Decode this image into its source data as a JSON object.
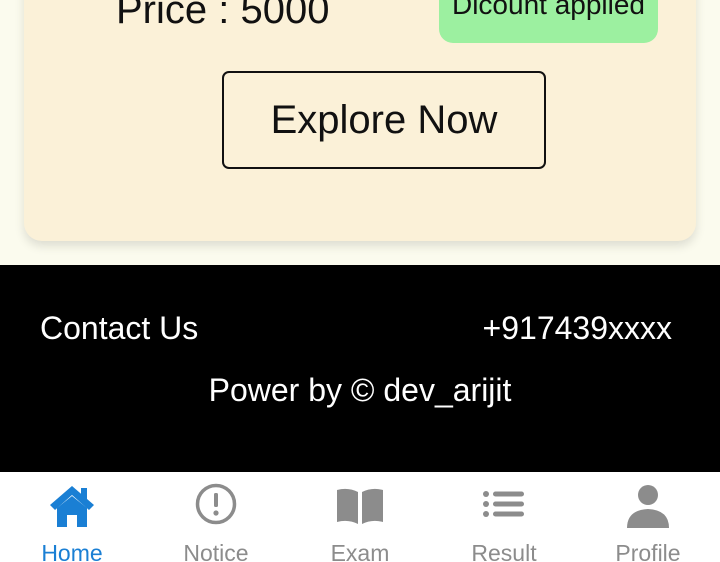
{
  "card": {
    "price_text": "Price : 5000",
    "badge_text": "Dicount applied",
    "explore_label": "Explore Now"
  },
  "footer": {
    "contact_label": "Contact Us",
    "phone": "+917439xxxx",
    "powered_text": "Power by © dev_arijit"
  },
  "nav": {
    "items": [
      {
        "label": "Home",
        "icon": "home-icon",
        "active": true
      },
      {
        "label": "Notice",
        "icon": "alert-circle-icon",
        "active": false
      },
      {
        "label": "Exam",
        "icon": "book-icon",
        "active": false
      },
      {
        "label": "Result",
        "icon": "list-icon",
        "active": false
      },
      {
        "label": "Profile",
        "icon": "user-icon",
        "active": false
      }
    ]
  },
  "colors": {
    "background": "#fbfbee",
    "card": "#fbf1d8",
    "badge": "#9cf0a0",
    "footer": "#000000",
    "nav_active": "#1a7fd4",
    "nav_inactive": "#8c8c8c"
  }
}
